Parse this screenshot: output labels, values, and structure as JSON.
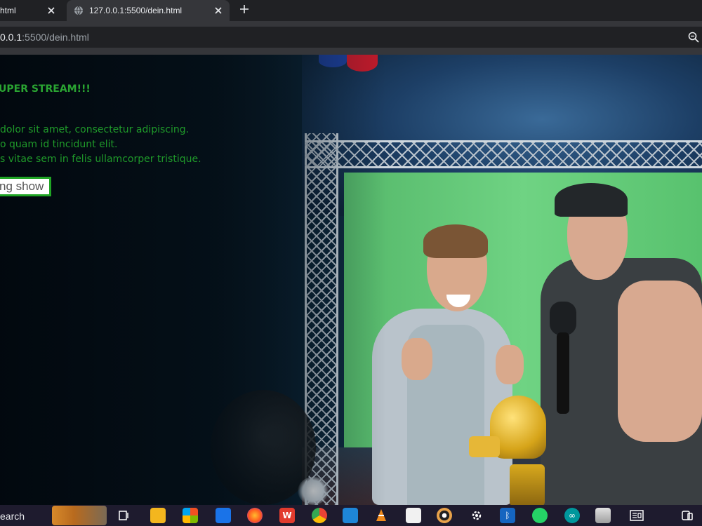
{
  "browser": {
    "tabs": [
      {
        "label": "html",
        "active": false
      },
      {
        "label": "127.0.0.1:5500/dein.html",
        "active": true
      }
    ],
    "new_tab_symbol": "+",
    "address": {
      "host": "0.0.1",
      "rest": ":5500/dein.html"
    }
  },
  "page": {
    "hero": {
      "title": "UPER STREAM!!!",
      "lines": [
        "dolor sit amet, consectetur adipiscing.",
        "o quam id tincidunt elit.",
        "s vitae sem in felis ullamcorper tristique."
      ],
      "button_label": "ng show"
    }
  },
  "taskbar": {
    "search_label": "earch",
    "icons": [
      "widgets",
      "task-view-icon",
      "file-explorer-icon",
      "store-icon",
      "mail-icon",
      "firefox-icon",
      "wps-icon",
      "chrome-icon",
      "vscode-icon",
      "vlc-icon",
      "file-icon",
      "media-icon",
      "settings-icon",
      "bluetooth-icon",
      "whatsapp-icon",
      "arduino-icon",
      "package-icon",
      "news-icon",
      "phone-link-icon"
    ]
  },
  "colors": {
    "accent_green": "#1f9a2a",
    "tab_bg": "#35363a",
    "strip_bg": "#202124",
    "taskbar_bg": "#1e1b2e"
  }
}
